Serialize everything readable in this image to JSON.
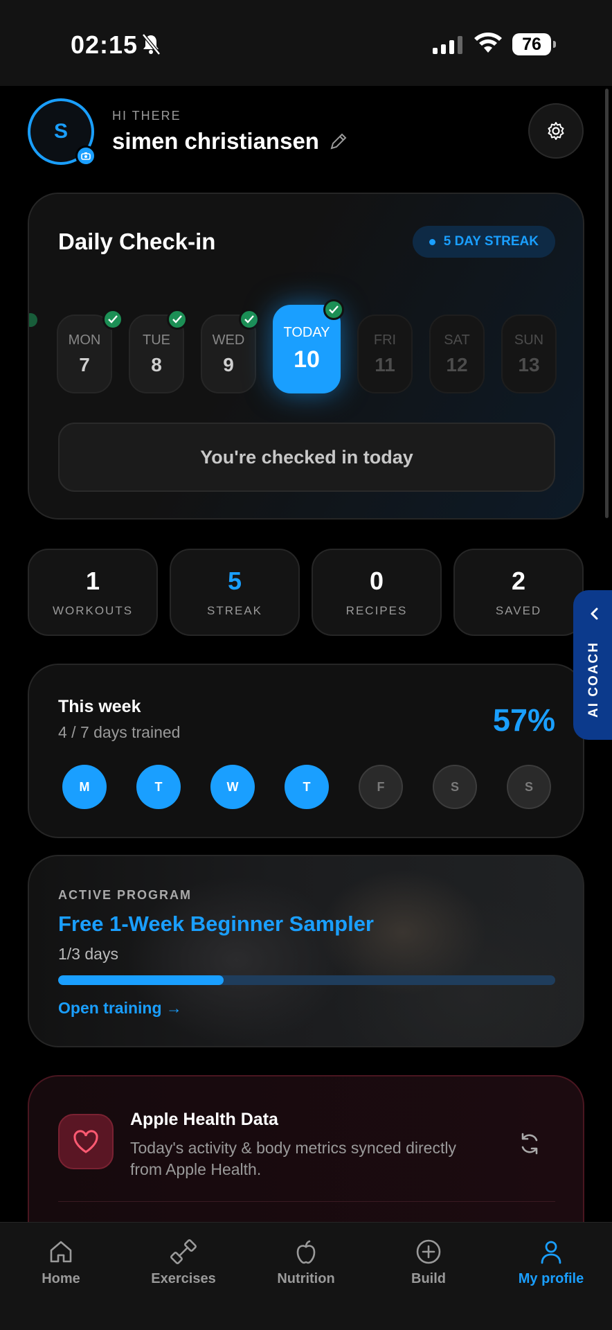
{
  "status": {
    "time": "02:15",
    "battery": "76"
  },
  "profile": {
    "greeting": "HI THERE",
    "name": "simen christiansen",
    "initial": "S"
  },
  "checkin": {
    "title": "Daily Check-in",
    "streak": "5 DAY STREAK",
    "days": [
      {
        "name": "MON",
        "num": "7",
        "state": "done"
      },
      {
        "name": "TUE",
        "num": "8",
        "state": "done"
      },
      {
        "name": "WED",
        "num": "9",
        "state": "done"
      },
      {
        "name": "TODAY",
        "num": "10",
        "state": "today"
      },
      {
        "name": "FRI",
        "num": "11",
        "state": "future"
      },
      {
        "name": "SAT",
        "num": "12",
        "state": "future"
      },
      {
        "name": "SUN",
        "num": "13",
        "state": "future"
      }
    ],
    "status_button": "You're checked in today"
  },
  "stats": [
    {
      "value": "1",
      "label": "WORKOUTS"
    },
    {
      "value": "5",
      "label": "STREAK"
    },
    {
      "value": "0",
      "label": "RECIPES"
    },
    {
      "value": "2",
      "label": "SAVED"
    }
  ],
  "ai_coach": {
    "label": "AI COACH"
  },
  "week": {
    "title": "This week",
    "subtitle": "4 / 7 days trained",
    "percent": "57%",
    "days": [
      {
        "letter": "M",
        "trained": true
      },
      {
        "letter": "T",
        "trained": true
      },
      {
        "letter": "W",
        "trained": true
      },
      {
        "letter": "T",
        "trained": true
      },
      {
        "letter": "F",
        "trained": false
      },
      {
        "letter": "S",
        "trained": false
      },
      {
        "letter": "S",
        "trained": false
      }
    ]
  },
  "program": {
    "label": "ACTIVE PROGRAM",
    "title": "Free 1-Week Beginner Sampler",
    "days": "1/3 days",
    "progress": 0.333,
    "link": "Open training →"
  },
  "health": {
    "title": "Apple Health Data",
    "description": "Today's activity & body metrics synced directly from Apple Health."
  },
  "tabs": [
    {
      "label": "Home",
      "icon": "home-icon"
    },
    {
      "label": "Exercises",
      "icon": "dumbbell-icon"
    },
    {
      "label": "Nutrition",
      "icon": "apple-icon"
    },
    {
      "label": "Build",
      "icon": "plus-circle-icon"
    },
    {
      "label": "My profile",
      "icon": "user-icon",
      "active": true
    }
  ],
  "colors": {
    "accent": "#1a9fff",
    "success": "#1c8f55",
    "health": "#5a1624"
  }
}
